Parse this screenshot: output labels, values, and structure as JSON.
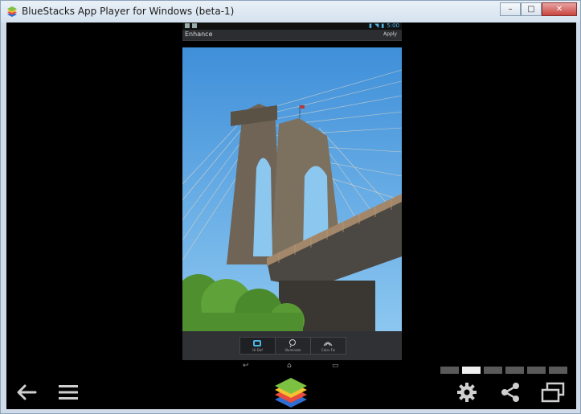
{
  "window": {
    "title": "BlueStacks App Player for Windows (beta-1)",
    "controls": [
      "minimize",
      "maximize",
      "close"
    ]
  },
  "android": {
    "status": {
      "time": "5:00"
    },
    "action_bar": {
      "title": "Enhance",
      "apply_label": "Apply"
    },
    "tools": [
      {
        "label": "Hi-Def",
        "icon": "hi-def-icon",
        "active": true
      },
      {
        "label": "Illuminate",
        "icon": "illuminate-icon",
        "active": false
      },
      {
        "label": "Color Fix",
        "icon": "color-fix-icon",
        "active": false
      }
    ],
    "nav": [
      "back-icon",
      "home-icon",
      "recents-icon"
    ]
  },
  "bluestacks": {
    "pager": {
      "count": 6,
      "active_index": 1
    },
    "bottom_icons": [
      "back-arrow-icon",
      "menu-icon",
      "bluestacks-logo",
      "settings-gear-icon",
      "share-icon",
      "fullscreen-icon"
    ]
  },
  "colors": {
    "accent": "#4db6e6",
    "toolbar": "#2f3135"
  }
}
